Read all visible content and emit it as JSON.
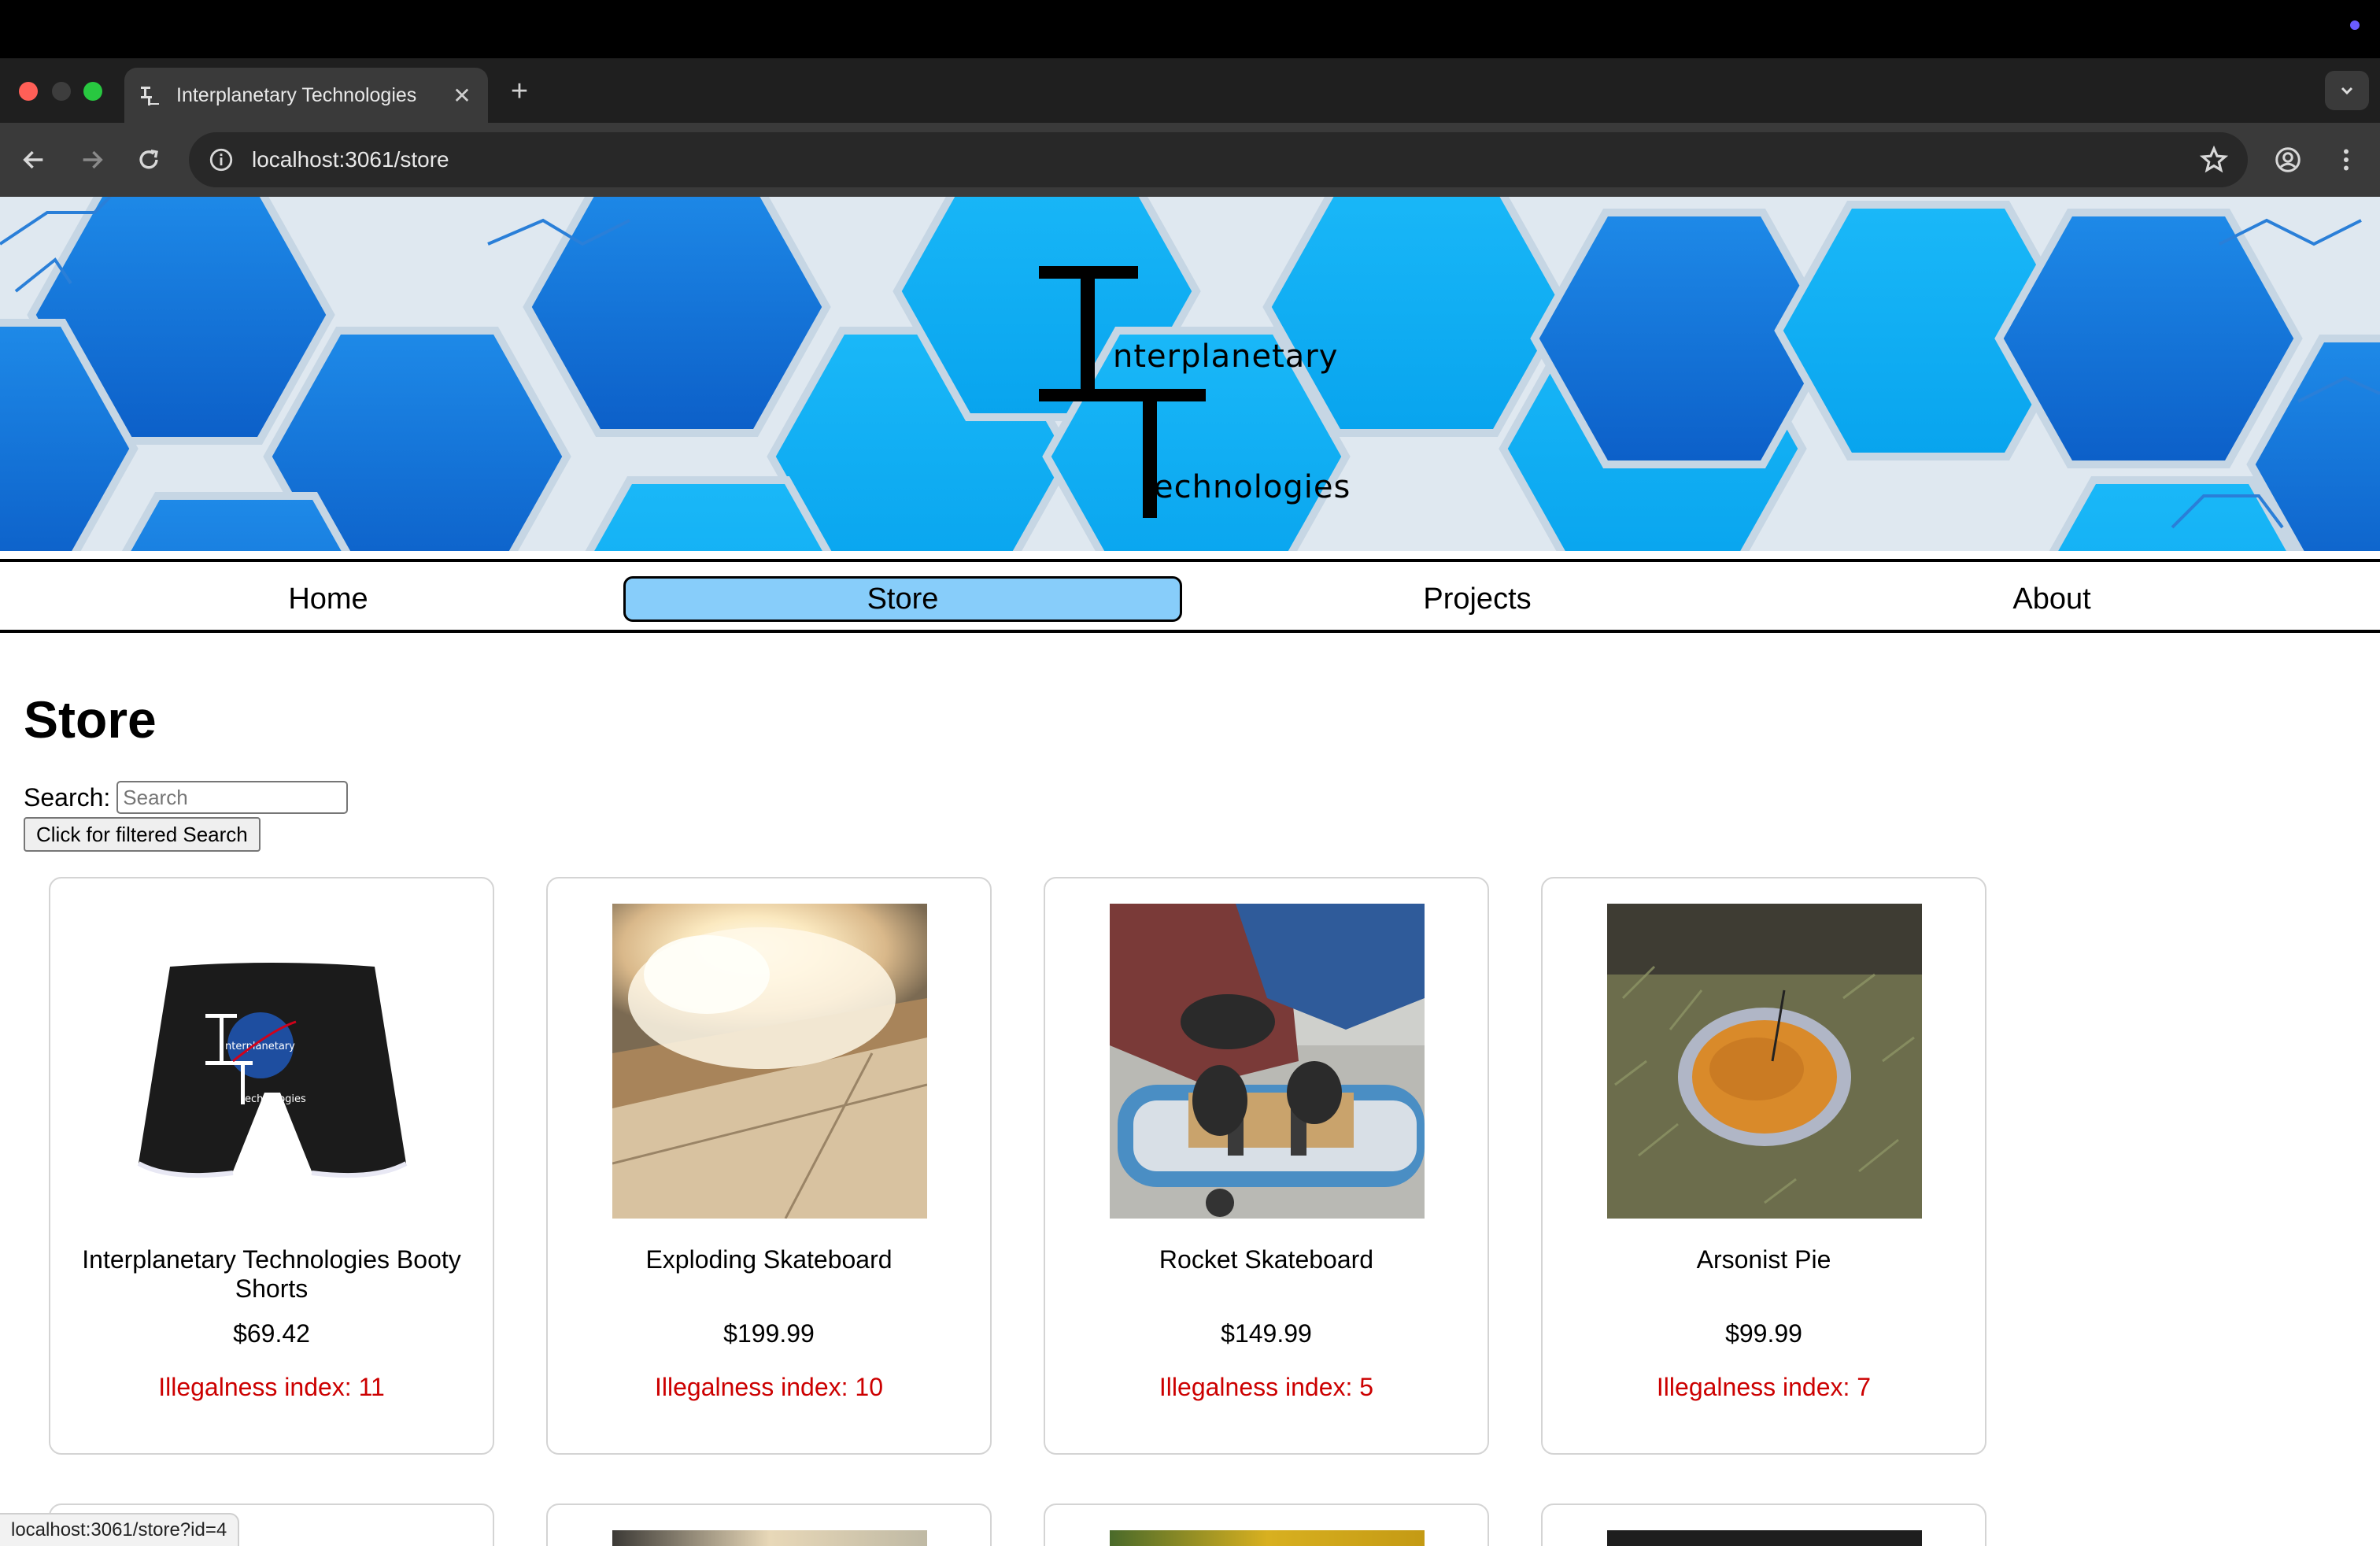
{
  "browser": {
    "tab_title": "Interplanetary Technologies",
    "url": "localhost:3061/store",
    "status_url": "localhost:3061/store?id=4"
  },
  "banner": {
    "logo_word_1": "nterplanetary",
    "logo_word_2": "echnologies"
  },
  "nav": {
    "items": [
      {
        "label": "Home"
      },
      {
        "label": "Store"
      },
      {
        "label": "Projects"
      },
      {
        "label": "About"
      }
    ],
    "active": "Store"
  },
  "store": {
    "heading": "Store",
    "search_label": "Search:",
    "search_placeholder": "Search",
    "search_value": "",
    "filter_button": "Click for filtered Search",
    "products": [
      {
        "name": "Interplanetary Technologies Booty Shorts",
        "price": "$69.42",
        "illegal": "Illegalness index: 11",
        "image": "black-shorts-with-logo"
      },
      {
        "name": "Exploding Skateboard",
        "price": "$199.99",
        "illegal": "Illegalness index: 10",
        "image": "explosion-on-sidewalk"
      },
      {
        "name": "Rocket Skateboard",
        "price": "$149.99",
        "illegal": "Illegalness index: 5",
        "image": "person-taping-skateboard"
      },
      {
        "name": "Arsonist Pie",
        "price": "$99.99",
        "illegal": "Illegalness index: 7",
        "image": "pie-tin-on-grass"
      }
    ]
  },
  "colors": {
    "nav_active_bg": "#87cdfa",
    "illegal_text": "#cc0000",
    "banner_blue": "#0aa0ef"
  }
}
